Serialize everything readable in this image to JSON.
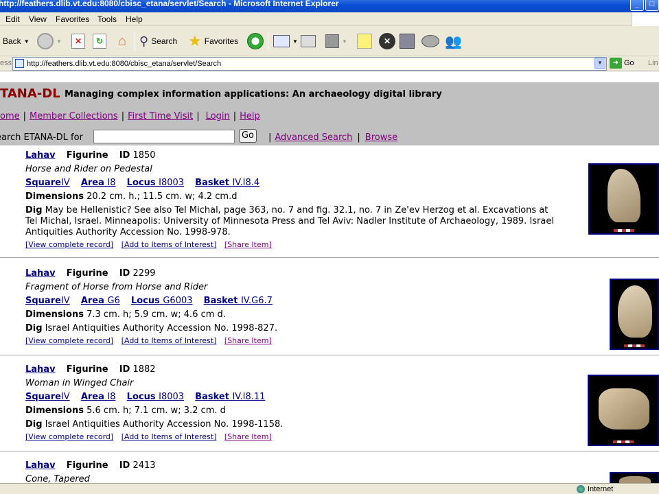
{
  "window": {
    "title": "http://feathers.dlib.vt.edu:8080/cbisc_etana/servlet/Search - Microsoft Internet Explorer"
  },
  "menu": [
    "Edit",
    "View",
    "Favorites",
    "Tools",
    "Help"
  ],
  "toolbar": {
    "back": "Back",
    "search": "Search",
    "favorites": "Favorites"
  },
  "address": {
    "label": "ess",
    "url": "http://feathers.dlib.vt.edu:8080/cbisc_etana/servlet/Search",
    "go": "Go",
    "links": "Lin"
  },
  "header": {
    "brand": "TANA-DL",
    "tagline": "Managing complex information applications:  An archaeology digital library",
    "nav": [
      "ome",
      "Member Collections",
      "First Time Visit",
      "Login",
      "Help"
    ],
    "search_label": "earch ETANA-DL for",
    "search_value": "",
    "search_go": "Go",
    "advanced": "Advanced Search",
    "browse": "Browse"
  },
  "labels": {
    "figurine": "Figurine",
    "id": "ID",
    "square": "Square",
    "area": "Area",
    "locus": "Locus",
    "basket": "Basket",
    "dimensions": "Dimensions",
    "dig": "Dig",
    "view": "[View complete record]",
    "add": "[Add to Items of Interest]",
    "share": "[Share Item]"
  },
  "records": [
    {
      "site": "Lahav",
      "id": "1850",
      "title": "Horse and Rider on Pedestal",
      "square": "IV",
      "area": "I8",
      "locus": "I8003",
      "basket": "IV.I8.4",
      "dimensions": "20.2 cm. h.; 11.5 cm. w; 4.2 cm.d",
      "dig": "May be Hellenistic? See also Tel Michal, page 363, no. 7 and fig. 32.1, no. 7 in Ze'ev Herzog et al. Excavations at Tel Michal, Israel. Minneapolis: University of Minnesota Press and Tel Aviv: Nadler Institute of Archaeology, 1989. Israel Antiquities Authority Accession No. 1998-978."
    },
    {
      "site": "Lahav",
      "id": "2299",
      "title": "Fragment of Horse from Horse and Rider",
      "square": "IV",
      "area": "G6",
      "locus": "G6003",
      "basket": "IV.G6.7",
      "dimensions": "7.3 cm. h; 5.9 cm. w; 4.6 cm d.",
      "dig": "Israel Antiquities Authority Accession No. 1998-827."
    },
    {
      "site": "Lahav",
      "id": "1882",
      "title": "Woman in Winged Chair",
      "square": "IV",
      "area": "I8",
      "locus": "I8003",
      "basket": "IV.I8.11",
      "dimensions": "5.6 cm. h; 7.1 cm. w; 3.2 cm. d",
      "dig": "Israel Antiquities Authority Accession No. 1998-1158."
    },
    {
      "site": "Lahav",
      "id": "2413",
      "title": "Cone, Tapered"
    }
  ],
  "status": {
    "zone": "Internet"
  }
}
